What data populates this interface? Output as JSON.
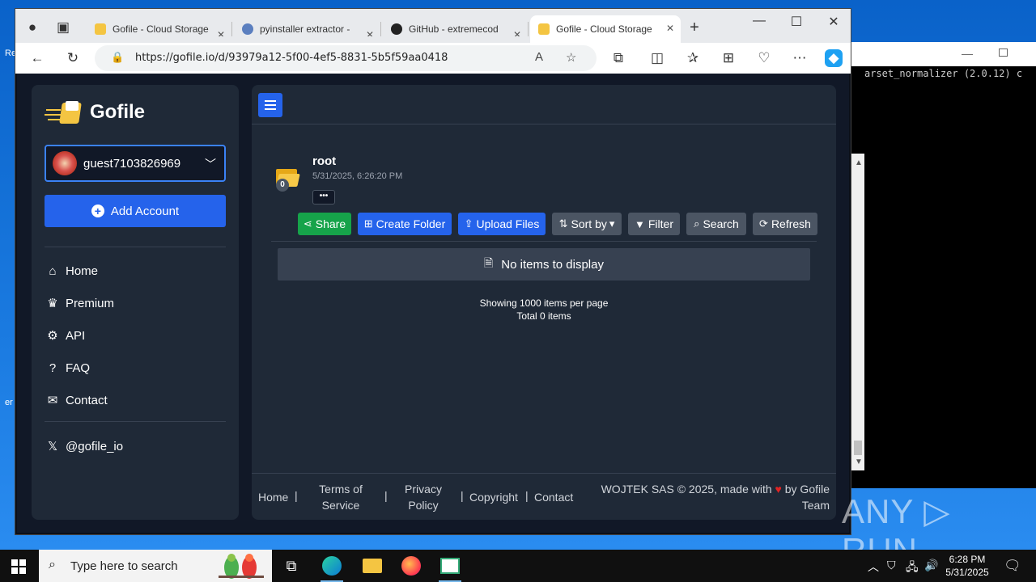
{
  "browser": {
    "tabs": [
      {
        "label": "Gofile - Cloud Storage",
        "active": false
      },
      {
        "label": "pyinstaller extractor -",
        "active": false
      },
      {
        "label": "GitHub - extremecod",
        "active": false
      },
      {
        "label": "Gofile - Cloud Storage",
        "active": true
      }
    ],
    "new_tab": "+",
    "url": "https://gofile.io/d/93979a12-5f00-4ef5-8831-5b5f59aa0418"
  },
  "sidebar": {
    "logo": "Gofile",
    "account_name": "guest7103826969",
    "add_account": "Add Account",
    "nav": [
      {
        "label": "Home",
        "icon": "home-icon"
      },
      {
        "label": "Premium",
        "icon": "crown-icon"
      },
      {
        "label": "API",
        "icon": "cogs-icon"
      },
      {
        "label": "FAQ",
        "icon": "question-icon"
      },
      {
        "label": "Contact",
        "icon": "envelope-icon"
      }
    ],
    "social": "@gofile_io"
  },
  "folder": {
    "name": "root",
    "date": "5/31/2025, 6:26:20 PM",
    "badge": "0",
    "more": "•••"
  },
  "actions": {
    "share": "Share",
    "create_folder": "Create Folder",
    "upload_files": "Upload Files",
    "sort_by": "Sort by",
    "filter": "Filter",
    "search": "Search",
    "refresh": "Refresh"
  },
  "content": {
    "empty": "No items to display",
    "per_page": "Showing 1000 items per page",
    "total": "Total 0 items"
  },
  "footer": {
    "home": "Home",
    "terms_1": "Terms of",
    "terms_2": "Service",
    "privacy_1": "Privacy",
    "privacy_2": "Policy",
    "copyright": "Copyright",
    "contact": "Contact",
    "credit_1": "WOJTEK SAS © 2025, made with",
    "credit_2": "by Gofile",
    "credit_3": "Team"
  },
  "terminal": {
    "text": "arset_normalizer (2.0.12) c"
  },
  "taskbar": {
    "search_placeholder": "Type here to search",
    "time": "6:28 PM",
    "date": "5/31/2025"
  },
  "watermark": "ANY ▷ RUN",
  "colors": {
    "accent_blue": "#2563eb",
    "share_green": "#16a34a",
    "panel": "#1f2937",
    "page_bg": "#111827"
  }
}
